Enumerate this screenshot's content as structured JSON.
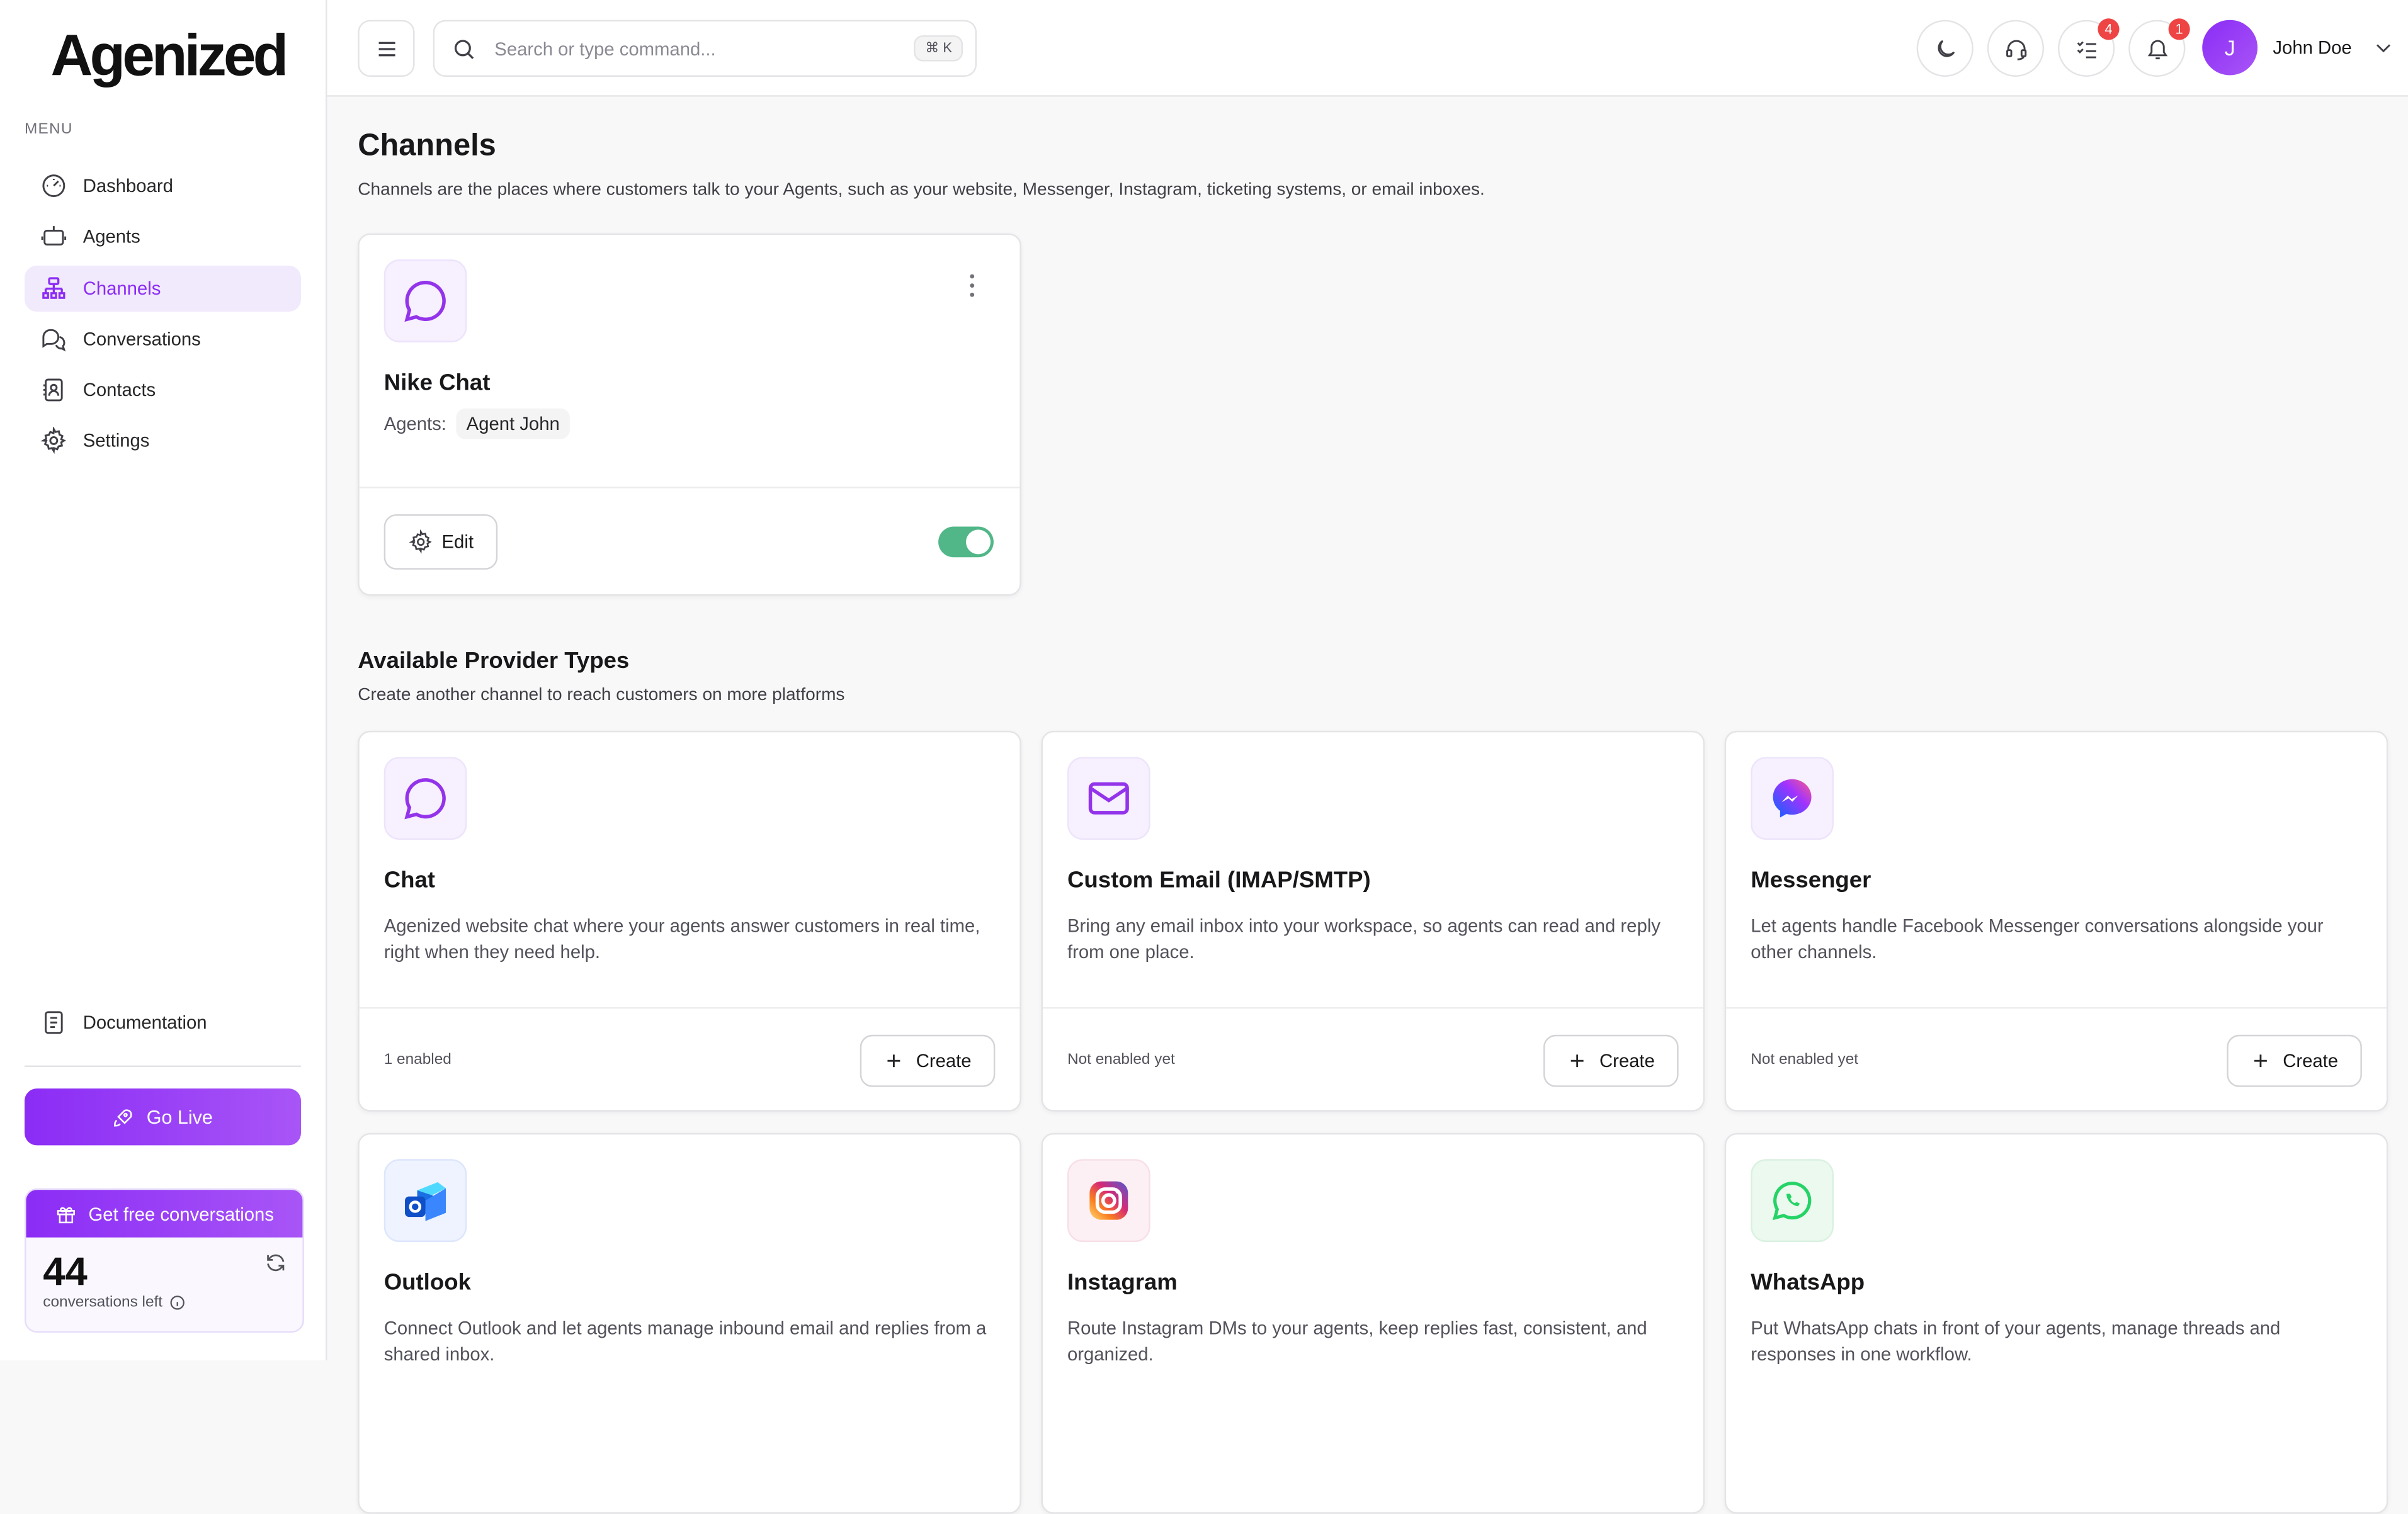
{
  "sidebar": {
    "logo": "Agenized",
    "menu_label": "MENU",
    "items": [
      {
        "label": "Dashboard"
      },
      {
        "label": "Agents"
      },
      {
        "label": "Channels"
      },
      {
        "label": "Conversations"
      },
      {
        "label": "Contacts"
      },
      {
        "label": "Settings"
      }
    ],
    "documentation": "Documentation",
    "go_live": "Go Live",
    "free_conversations": {
      "header": "Get free conversations",
      "count": "44",
      "label": "conversations left"
    }
  },
  "topbar": {
    "search_placeholder": "Search or type command...",
    "shortcut": "⌘ K",
    "tasks_badge": "4",
    "notifications_badge": "1",
    "avatar_initial": "J",
    "user_name": "John Doe"
  },
  "page": {
    "title": "Channels",
    "subtitle": "Channels are the places where customers talk to your Agents, such as your website, Messenger, Instagram, ticketing systems, or email inboxes."
  },
  "channel": {
    "name": "Nike Chat",
    "agents_label": "Agents:",
    "agent": "Agent John",
    "edit_label": "Edit",
    "enabled": true
  },
  "providers": {
    "title": "Available Provider Types",
    "subtitle": "Create another channel to reach customers on more platforms",
    "create_label": "Create",
    "items": [
      {
        "name": "Chat",
        "desc": "Agenized website chat where your agents answer customers in real time, right when they need help.",
        "status": "1 enabled"
      },
      {
        "name": "Custom Email (IMAP/SMTP)",
        "desc": "Bring any email inbox into your workspace, so agents can read and reply from one place.",
        "status": "Not enabled yet"
      },
      {
        "name": "Messenger",
        "desc": "Let agents handle Facebook Messenger conversations alongside your other channels.",
        "status": "Not enabled yet"
      },
      {
        "name": "Outlook",
        "desc": "Connect Outlook and let agents manage inbound email and replies from a shared inbox."
      },
      {
        "name": "Instagram",
        "desc": "Route Instagram DMs to your agents, keep replies fast, consistent, and organized."
      },
      {
        "name": "WhatsApp",
        "desc": "Put WhatsApp chats in front of your agents, manage threads and responses in one workflow."
      }
    ]
  },
  "colors": {
    "accent": "#8b2cf5",
    "toggle_on": "#52b788",
    "badge": "#ef4444"
  }
}
